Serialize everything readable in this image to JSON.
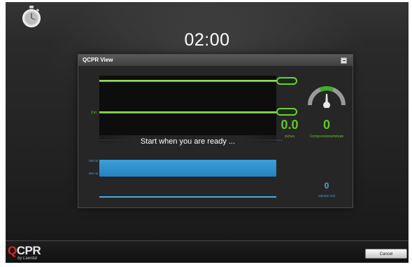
{
  "timer": {
    "value": "02:00"
  },
  "qcpr_panel": {
    "title": "QCPR View",
    "depth": {
      "target_label": "2 in",
      "value": "0.0",
      "unit": "inches"
    },
    "rate": {
      "value": "0",
      "label": "Compressions/minute"
    },
    "status_message": "Start when you are ready ...",
    "volume": {
      "upper_label": "700 ml",
      "lower_label": "400 ml",
      "value": "0",
      "label": "Volume (ml)"
    }
  },
  "footer": {
    "logo_main": "CPR",
    "logo_q": "Q",
    "logo_sub": "by Laerdal",
    "cancel_label": "Cancel"
  },
  "colors": {
    "green": "#5fc72a",
    "blue": "#4ba7e0",
    "brand_red": "#e2231a"
  },
  "icons": {
    "stopwatch": "stopwatch-icon",
    "minimize": "minimize-icon",
    "gauge": "rate-gauge-icon"
  }
}
